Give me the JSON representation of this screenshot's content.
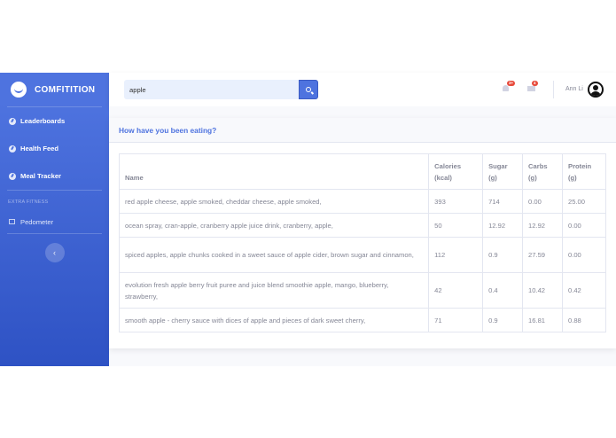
{
  "sidebar": {
    "brand": "COMFITITION",
    "items": [
      {
        "label": "Leaderboards",
        "icon": "dashboard-icon"
      },
      {
        "label": "Health Feed",
        "icon": "dashboard-icon"
      },
      {
        "label": "Meal Tracker",
        "icon": "dashboard-icon"
      }
    ],
    "heading": "EXTRA FITNESS",
    "sub_items": [
      {
        "label": "Pedometer",
        "icon": "table-icon"
      }
    ],
    "toggle_icon": "chevron-left-icon"
  },
  "topbar": {
    "search": {
      "value": "apple",
      "icon": "search-icon"
    },
    "alerts_badge": "3+",
    "messages_badge": "4",
    "user_name": "Ann Li"
  },
  "main": {
    "card_title": "How have you been eating?",
    "table": {
      "headers": [
        "Name",
        "Calories\n(kcal)",
        "Sugar\n(g)",
        "Carbs\n(g)",
        "Protein\n(g)"
      ],
      "rows": [
        [
          "red apple cheese, apple smoked, cheddar cheese, apple smoked,",
          "393",
          "714",
          "0.00",
          "25.00"
        ],
        [
          "ocean spray, cran-apple, cranberry apple juice drink, cranberry, apple,",
          "50",
          "12.92",
          "12.92",
          "0.00"
        ],
        [
          "spiced apples, apple chunks cooked in a sweet sauce of apple cider, brown sugar and cinnamon,",
          "112",
          "0.9",
          "27.59",
          "0.00"
        ],
        [
          "evolution fresh apple berry fruit puree and juice blend smoothie apple, mango, blueberry, strawberry,",
          "42",
          "0.4",
          "10.42",
          "0.42"
        ],
        [
          "smooth apple - cherry sauce with dices of apple and pieces of dark sweet cherry,",
          "71",
          "0.9",
          "16.81",
          "0.88"
        ]
      ]
    }
  },
  "colors": {
    "primary": "#4e73df",
    "danger": "#e74a3b",
    "muted_text": "#858796"
  }
}
